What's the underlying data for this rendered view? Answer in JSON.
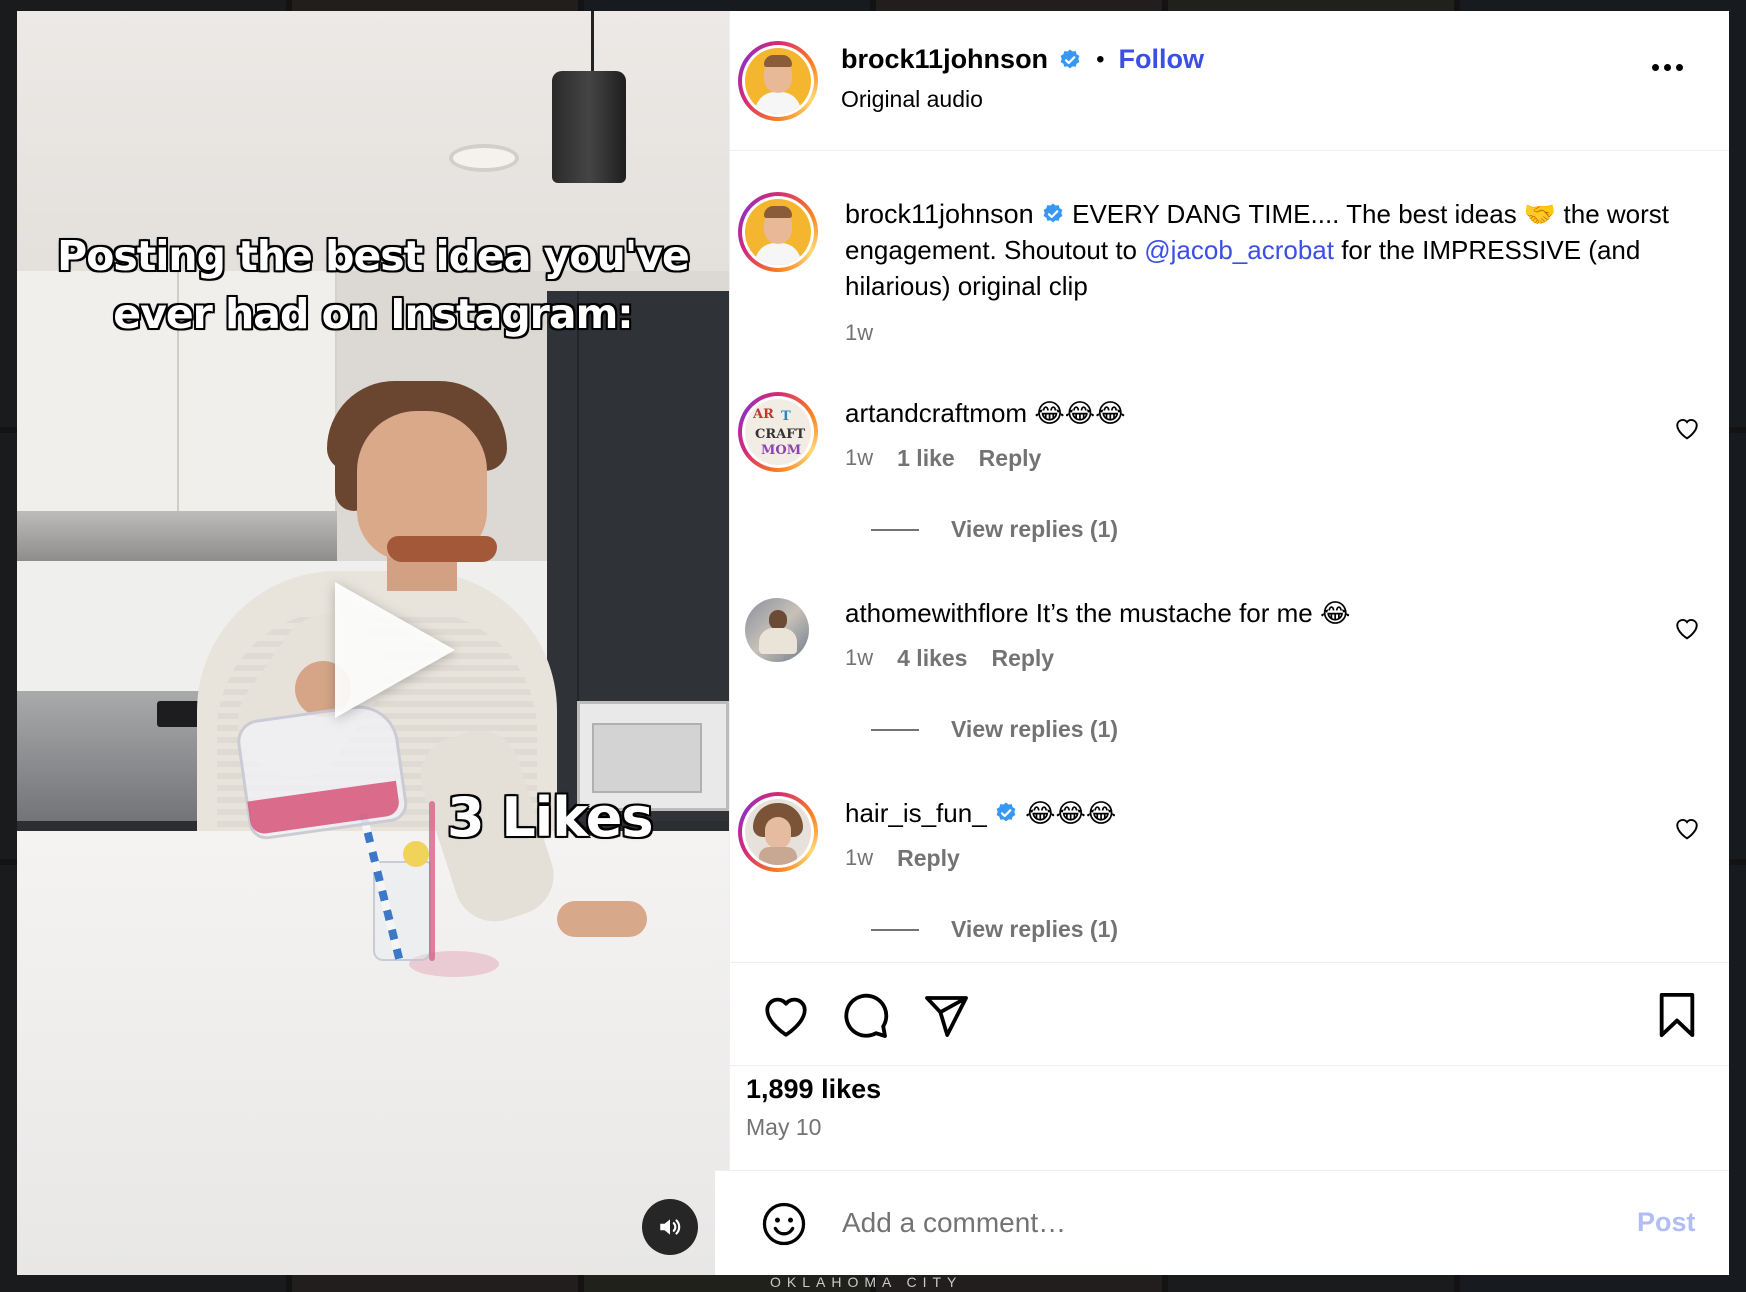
{
  "background_footer": "OKLAHOMA CITY",
  "media": {
    "headline": "Posting the best idea you've ever had on Instagram:",
    "overlay_likes": "3 Likes",
    "play_icon": "play-icon",
    "mute_icon": "speaker-icon"
  },
  "header": {
    "username": "brock11johnson",
    "verified": true,
    "separator": "•",
    "follow_label": "Follow",
    "subtitle": "Original audio",
    "more_icon": "more-horizontal-icon"
  },
  "caption": {
    "username": "brock11johnson",
    "text_before_mention": "EVERY DANG TIME.... The best ideas 🤝 the worst engagement. Shoutout to ",
    "mention": "@jacob_acrobat",
    "text_after_mention": " for the IMPRESSIVE (and hilarious) original clip",
    "time": "1w"
  },
  "comments": [
    {
      "username": "artandcraftmom",
      "verified": false,
      "text": "😂😂😂",
      "time": "1w",
      "likes": "1 like",
      "reply_label": "Reply",
      "view_replies": "View replies (1)"
    },
    {
      "username": "athomewithflore",
      "verified": false,
      "text": "It’s the mustache for me 😂",
      "time": "1w",
      "likes": "4 likes",
      "reply_label": "Reply",
      "view_replies": "View replies (1)"
    },
    {
      "username": "hair_is_fun_",
      "verified": true,
      "text": "😂😂😂",
      "time": "1w",
      "likes": "",
      "reply_label": "Reply",
      "view_replies": "View replies (1)"
    }
  ],
  "actions": {
    "like_icon": "heart-icon",
    "comment_icon": "comment-icon",
    "share_icon": "share-icon",
    "save_icon": "bookmark-icon"
  },
  "stats": {
    "likes": "1,899 likes",
    "date": "May 10"
  },
  "composer": {
    "emoji_icon": "emoji-icon",
    "placeholder": "Add a comment…",
    "post_label": "Post"
  },
  "colors": {
    "link_blue": "#3b4fe4",
    "verified_blue": "#3897f0",
    "secondary_text": "#737373",
    "post_disabled": "#b3bdf5"
  }
}
